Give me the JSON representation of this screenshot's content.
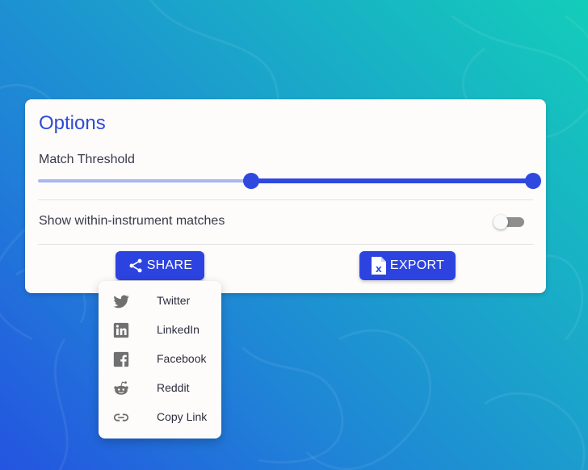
{
  "options": {
    "title": "Options",
    "slider": {
      "label": "Match Threshold",
      "low_value_pct": 43,
      "high_value_pct": 100
    },
    "toggle": {
      "label": "Show within-instrument matches",
      "checked": false
    }
  },
  "actions": {
    "share_label": "SHARE",
    "export_label": "EXPORT"
  },
  "share_menu": {
    "items": [
      {
        "label": "Twitter",
        "icon": "twitter-icon"
      },
      {
        "label": "LinkedIn",
        "icon": "linkedin-icon"
      },
      {
        "label": "Facebook",
        "icon": "facebook-icon"
      },
      {
        "label": "Reddit",
        "icon": "reddit-icon"
      },
      {
        "label": "Copy Link",
        "icon": "link-icon"
      }
    ]
  },
  "colors": {
    "accent": "#2d43e0",
    "title": "#2f49d6",
    "track_light": "#aab6f2",
    "icon_gray": "#707070"
  }
}
